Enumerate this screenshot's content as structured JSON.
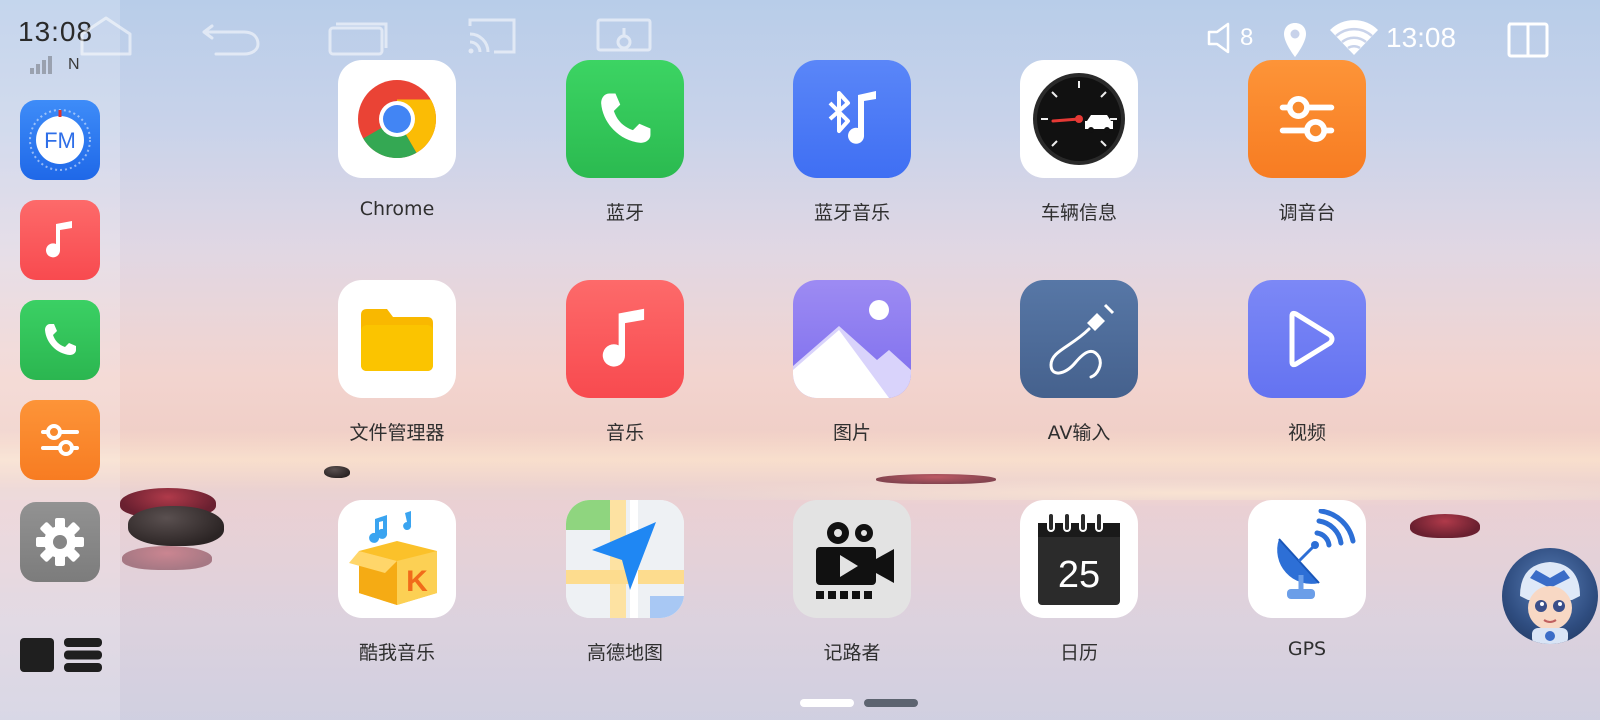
{
  "status_bar": {
    "left_time": "13:08",
    "network_type": "N",
    "volume_level": "8",
    "right_time": "13:08"
  },
  "dock": {
    "items": [
      {
        "name": "fm-radio",
        "icon": "fm-radio-icon",
        "text": "FM",
        "color": "#2f7cf6"
      },
      {
        "name": "music",
        "icon": "music-note-icon",
        "color": "#fb5a5a"
      },
      {
        "name": "phone",
        "icon": "phone-icon",
        "color": "#34c759"
      },
      {
        "name": "equalizer",
        "icon": "sliders-icon",
        "color": "#fb8a2e"
      },
      {
        "name": "settings",
        "icon": "gear-icon",
        "color": "#8a8a8a"
      }
    ]
  },
  "top_nav": {
    "items": [
      "home-icon",
      "back-icon",
      "recent-apps-icon",
      "cast-icon",
      "screen-mirror-icon"
    ]
  },
  "apps": [
    {
      "label": "Chrome",
      "icon": "chrome-icon"
    },
    {
      "label": "蓝牙",
      "icon": "phone-icon"
    },
    {
      "label": "蓝牙音乐",
      "icon": "bluetooth-music-icon"
    },
    {
      "label": "车辆信息",
      "icon": "speedometer-icon"
    },
    {
      "label": "调音台",
      "icon": "sliders-icon"
    },
    {
      "label": "文件管理器",
      "icon": "folder-icon"
    },
    {
      "label": "音乐",
      "icon": "music-note-icon"
    },
    {
      "label": "图片",
      "icon": "gallery-icon"
    },
    {
      "label": "AV输入",
      "icon": "av-cable-icon"
    },
    {
      "label": "视频",
      "icon": "play-icon"
    },
    {
      "label": "酷我音乐",
      "icon": "kuwo-box-icon"
    },
    {
      "label": "高德地图",
      "icon": "map-navigation-icon"
    },
    {
      "label": "记路者",
      "icon": "dashcam-icon"
    },
    {
      "label": "日历",
      "icon": "calendar-icon",
      "day": "25"
    },
    {
      "label": "GPS",
      "icon": "satellite-dish-icon"
    }
  ],
  "pager": {
    "current_page": 1,
    "total_pages": 2
  },
  "colors": {
    "chrome_red": "#ea4335",
    "chrome_yellow": "#fbbc05",
    "chrome_green": "#34a853",
    "chrome_blue": "#4285f4",
    "phone_green": "#34c759",
    "bt_blue": "#4a7cf7",
    "eq_orange": "#fb8a2e",
    "folder_yellow": "#f9b800",
    "music_red": "#fb5a5a",
    "gallery_purple": "#8b7cf0",
    "av_slate": "#4a6a9a",
    "video_indigo": "#6f7ef5"
  }
}
